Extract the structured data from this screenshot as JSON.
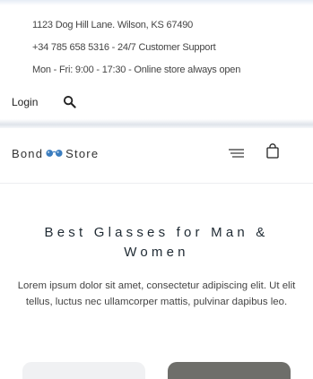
{
  "topbar": {
    "address": "1123 Dog Hill Lane. Wilson, KS 67490",
    "phone": "+34 785 658 5316 - 24/7 Customer Support",
    "hours": "Mon - Fri: 9:00 - 17:30 - Online store always open",
    "login_label": "Login"
  },
  "brand": {
    "name_left": "Bond",
    "name_right": "Store"
  },
  "hero": {
    "title": "Best Glasses for Man & Women",
    "text": "Lorem ipsum dolor sit amet, consectetur adipiscing elit. Ut elit tellus, luctus nec ullamcorper mattis, pulvinar dapibus leo."
  },
  "icons": {
    "search": "search-icon",
    "logo": "glasses-icon",
    "menu": "hamburger-menu-icon",
    "cart": "shopping-bag-icon"
  },
  "colors": {
    "text_dark": "#1f2a33",
    "logo_blue": "#3b7dbf",
    "card_dark": "#6e6e6a",
    "card_light": "#f0f1f3"
  }
}
